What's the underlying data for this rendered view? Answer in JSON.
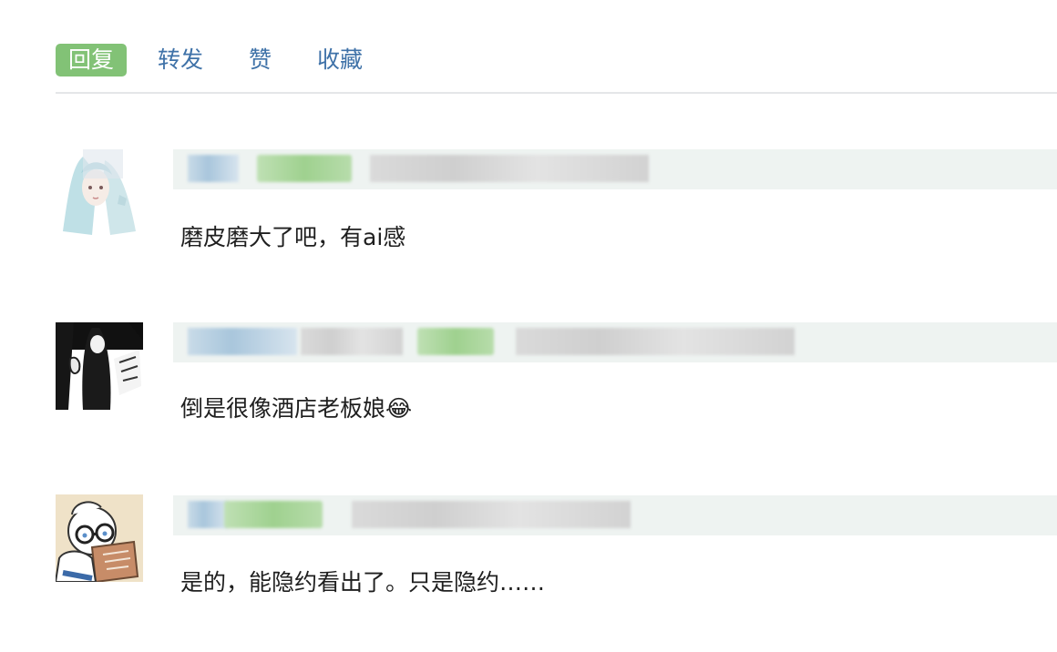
{
  "actions": {
    "reply": "回复",
    "forward": "转发",
    "like": "赞",
    "favorite": "收藏"
  },
  "comments": [
    {
      "text": "磨皮磨大了吧，有ai感",
      "avatar_icon": "anime-girl-avatar"
    },
    {
      "text": "倒是很像酒店老板娘😂",
      "avatar_icon": "ink-figure-avatar"
    },
    {
      "text": "是的，能隐约看出了。只是隐约……",
      "avatar_icon": "reading-character-avatar"
    }
  ],
  "colors": {
    "accent_green": "#82c276",
    "link_blue": "#3f72a8",
    "meta_bg": "#eef3f1"
  }
}
